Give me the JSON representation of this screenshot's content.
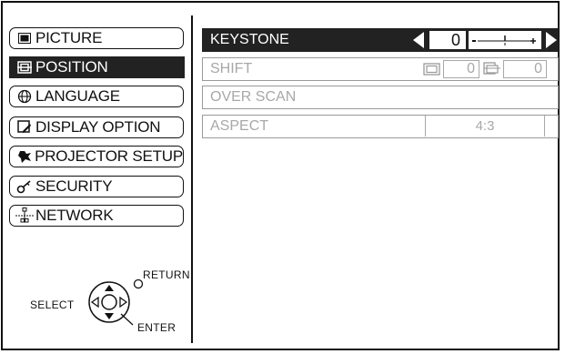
{
  "menu": {
    "items": [
      {
        "label": "PICTURE",
        "icon": "picture-icon",
        "selected": false
      },
      {
        "label": "POSITION",
        "icon": "position-icon",
        "selected": true
      },
      {
        "label": "LANGUAGE",
        "icon": "globe-icon",
        "selected": false
      },
      {
        "label": "DISPLAY OPTION",
        "icon": "display-option-icon",
        "selected": false
      },
      {
        "label": "PROJECTOR SETUP",
        "icon": "wrench-icon",
        "selected": false
      },
      {
        "label": "SECURITY",
        "icon": "key-icon",
        "selected": false
      },
      {
        "label": "NETWORK",
        "icon": "network-icon",
        "selected": false
      }
    ]
  },
  "settings": {
    "keystone": {
      "label": "KEYSTONE",
      "value": "0",
      "slider_marks": "- +"
    },
    "shift": {
      "label": "SHIFT",
      "h_value": "0",
      "v_value": "0"
    },
    "over_scan": {
      "label": "OVER SCAN"
    },
    "aspect": {
      "label": "ASPECT",
      "value": "4:3"
    }
  },
  "controls": {
    "select_label": "SELECT",
    "return_label": "RETURN",
    "enter_label": "ENTER"
  },
  "colors": {
    "selected_bg": "#222222",
    "disabled_text": "#a8a8a8",
    "border": "#111111"
  }
}
